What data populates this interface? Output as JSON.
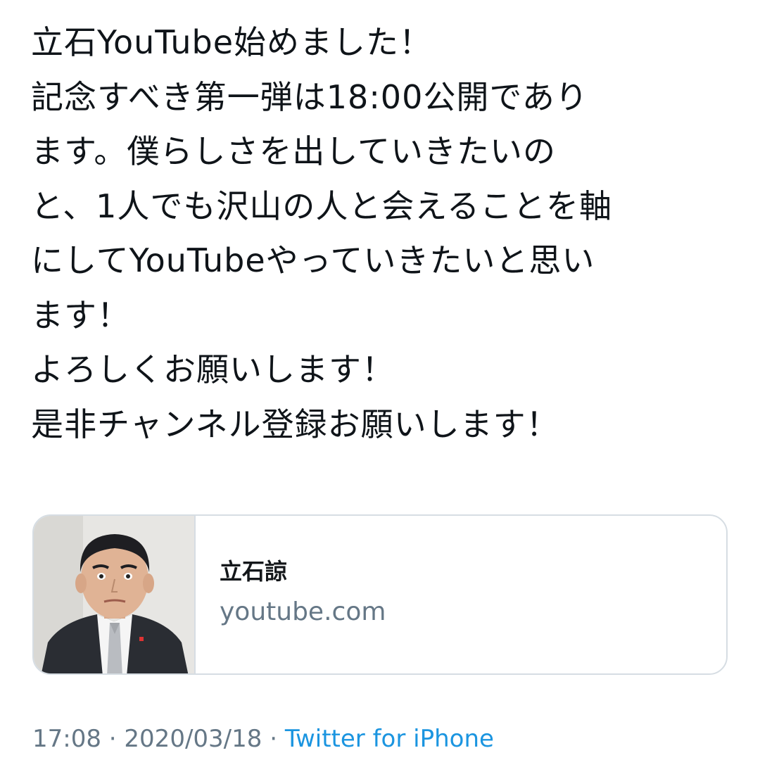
{
  "tweet": {
    "lines": [
      "立石YouTube始めました！",
      "記念すべき第一弾は18:00公開であり",
      "ます。僕らしさを出していきたいの",
      "と、1人でも沢山の人と会えることを軸",
      "にしてYouTubeやっていきたいと思い",
      "ます！",
      "よろしくお願いします！",
      "是非チャンネル登録お願いします！"
    ]
  },
  "link_card": {
    "title": "立石諒",
    "domain": "youtube.com",
    "thumbnail": "person-photo"
  },
  "meta": {
    "time": "17:08",
    "separator1": " · ",
    "date": "2020/03/18",
    "separator2": " · ",
    "source": "Twitter for iPhone"
  },
  "colors": {
    "text": "#0f1419",
    "secondary": "#657786",
    "link": "#1b95e0",
    "border": "#d6dde3"
  }
}
